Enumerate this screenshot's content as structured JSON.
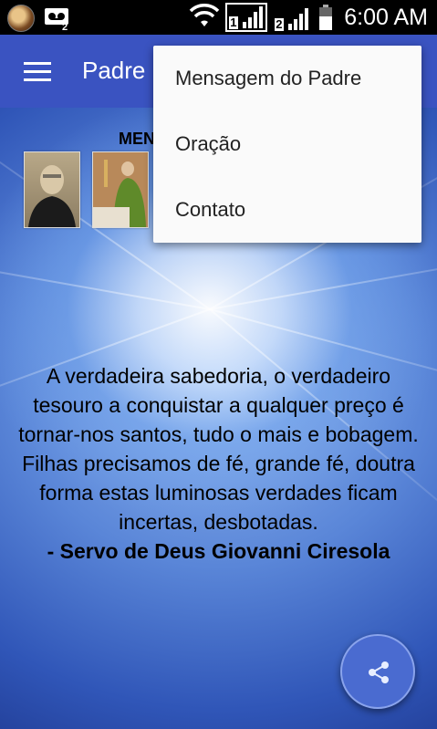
{
  "status_bar": {
    "time": "6:00 AM",
    "sim1": "1",
    "sim2": "2"
  },
  "app_bar": {
    "title": "Padre"
  },
  "content": {
    "section_header": "MEN",
    "quote_text": "A verdadeira sabedoria, o verdadeiro tesouro a conquistar a qualquer preço é tornar-nos santos, tudo o mais e bobagem. Filhas precisamos de fé, grande fé, doutra forma estas luminosas verdades ficam incertas, desbotadas.",
    "quote_author": "- Servo de Deus Giovanni Ciresola"
  },
  "overflow_menu": {
    "items": [
      {
        "label": "Mensagem do Padre"
      },
      {
        "label": "Oração"
      },
      {
        "label": "Contato"
      }
    ]
  },
  "icons": {
    "menu": "hamburger-icon",
    "share": "share-icon",
    "wifi": "wifi-icon",
    "signal": "signal-icon",
    "battery": "battery-icon",
    "voicemail": "voicemail-icon"
  },
  "colors": {
    "app_bar": "#3a53c1",
    "fab": "#4a6bd0",
    "menu_bg": "#fafafa"
  }
}
